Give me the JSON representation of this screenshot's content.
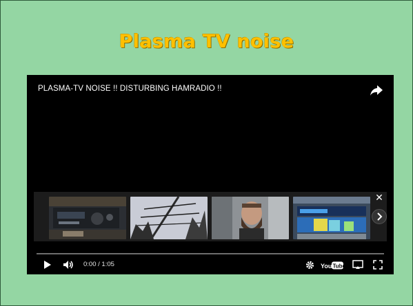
{
  "slide": {
    "title": "Plasma TV noise",
    "title_color": "#ffc000",
    "background": "#94d6a3"
  },
  "player": {
    "video_title": "PLASMA-TV NOISE !! DISTURBING HAMRADIO !!",
    "time_display": "0:00 / 1:05",
    "progress": 0,
    "related_videos": [
      {
        "icon": "radio-transceiver-thumbnail"
      },
      {
        "icon": "antenna-tower-thumbnail"
      },
      {
        "icon": "bearded-man-in-car-thumbnail"
      },
      {
        "icon": "spectrum-display-thumbnail"
      }
    ],
    "controls": {
      "play_icon": "play-icon",
      "volume_icon": "volume-icon",
      "settings_icon": "gear-icon",
      "youtube_label": "YouTube",
      "cast_icon": "cast-icon",
      "fullscreen_icon": "fullscreen-icon",
      "share_icon": "share-icon"
    }
  }
}
